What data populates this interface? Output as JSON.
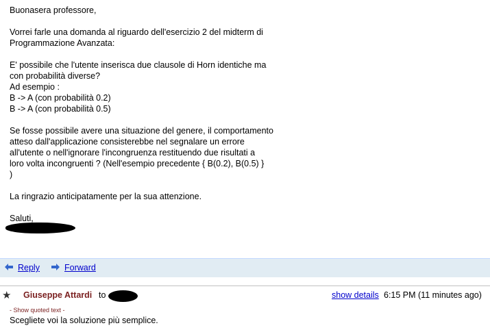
{
  "message1": {
    "greeting": "Buonasera professore,",
    "para1": [
      "Vorrei farle una domanda al riguardo dell'esercizio 2 del midterm di",
      "Programmazione Avanzata:"
    ],
    "para2": [
      "E' possibile che l'utente inserisca due clausole di Horn identiche ma",
      "con probabilità diverse?",
      "Ad esempio :",
      "B -> A (con probabilità 0.2)",
      "B -> A (con probabilità 0.5)"
    ],
    "para3": [
      "Se fosse possibile avere una situazione del genere, il comportamento",
      "atteso dall'applicazione consisterebbe nel segnalare un errore",
      "all'utente o nell'ignorare l'incongruenza restituendo due risultati a",
      "loro volta incongruenti ? (Nell'esempio precedente { B(0.2), B(0.5) }",
      ")"
    ],
    "para4": "La ringrazio anticipatamente per la sua attenzione.",
    "closing": "Saluti,"
  },
  "actions": {
    "reply_label": "Reply",
    "forward_label": "Forward",
    "reply_icon": "reply-arrow-icon",
    "forward_icon": "forward-arrow-icon"
  },
  "message2": {
    "sender": "Giuseppe Attardi",
    "to_label": "to",
    "show_details_label": "show details",
    "time": "6:15 PM (11 minutes ago)",
    "show_quoted_label": "- Show quoted text -",
    "body": "Scegliete voi la soluzione più semplice.",
    "sender_color": "#7a1f1f",
    "link_color": "#0000cc",
    "actionbar_color": "#e1ecf3"
  }
}
